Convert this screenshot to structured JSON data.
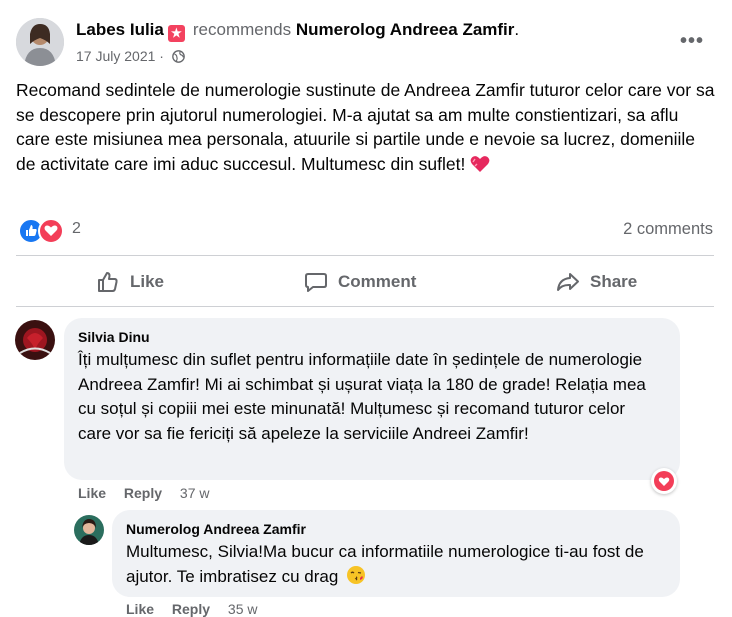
{
  "post": {
    "author": "Labes Iulia",
    "recommends_word": "recommends",
    "page_name": "Numerolog Andreea Zamfir",
    "page_suffix": ".",
    "date": "17 July 2021",
    "date_separator": "·",
    "more_label": "•••",
    "text": "Recomand sedintele de numerologie sustinute de Andreea Zamfir tuturor celor care vor sa se descopere prin ajutorul numerologiei. M-a ajutat sa am multe constientizari, sa aflu care este misiunea mea personala, atuurile si partile unde e nevoie sa lucrez, domeniile de activitate care imi aduc succesul. Multumesc din suflet!",
    "reaction_count": "2",
    "comments_count": "2 comments"
  },
  "actions": {
    "like": "Like",
    "comment": "Comment",
    "share": "Share"
  },
  "comments": [
    {
      "author": "Silvia Dinu",
      "text": "Îți mulțumesc din suflet pentru informațiile date în ședințele de numerologie Andreea Zamfir! Mi ai schimbat și ușurat viața la 180 de grade! Relația mea cu soțul și copiii mei este minunată! Mulțumesc și recomand tuturor celor care vor sa fie fericiți să apeleze la serviciile Andreei Zamfir!",
      "like": "Like",
      "reply": "Reply",
      "time": "37 w"
    },
    {
      "author": "Numerolog Andreea Zamfir",
      "text": "Multumesc, Silvia!Ma bucur ca informatiile numerologice ti-au fost de ajutor. Te imbratisez cu drag",
      "like": "Like",
      "reply": "Reply",
      "time": "35 w"
    }
  ],
  "colors": {
    "like_blue": "#1877f2",
    "love_red": "#f33e58",
    "secondary_text": "#65676b",
    "bubble_bg": "#f0f2f5"
  },
  "icons": [
    "avatar",
    "recommend-badge-icon",
    "globe-icon",
    "more-icon",
    "like-reaction-icon",
    "love-reaction-icon",
    "heart-emoji-icon",
    "thumbs-up-icon",
    "comment-icon",
    "share-icon",
    "kiss-emoji-icon"
  ]
}
